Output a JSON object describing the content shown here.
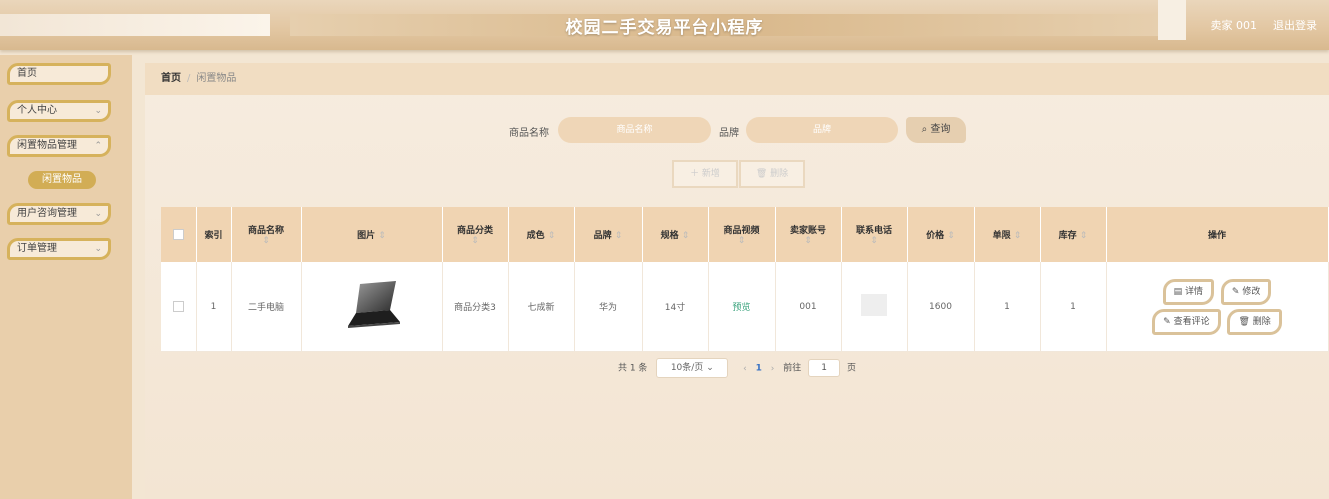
{
  "header": {
    "title": "校园二手交易平台小程序",
    "user": "卖家 001",
    "logout": "退出登录"
  },
  "sidebar": {
    "items": [
      {
        "label": "首页"
      },
      {
        "label": "个人中心"
      },
      {
        "label": "闲置物品管理"
      },
      {
        "label": "闲置物品"
      },
      {
        "label": "用户咨询管理"
      },
      {
        "label": "订单管理"
      }
    ]
  },
  "breadcrumb": {
    "home": "首页",
    "current": "闲置物品"
  },
  "search": {
    "name_label": "商品名称",
    "name_placeholder": "商品名称",
    "brand_label": "品牌",
    "brand_placeholder": "品牌",
    "query": "查询"
  },
  "actions": {
    "add": "＋ 新增",
    "delete": "删除"
  },
  "table": {
    "headers": [
      "索引",
      "商品名称",
      "图片",
      "商品分类",
      "成色",
      "品牌",
      "规格",
      "商品视频",
      "卖家账号",
      "联系电话",
      "价格",
      "单限",
      "库存",
      "操作"
    ],
    "rows": [
      {
        "index": "1",
        "name": "二手电脑",
        "category": "商品分类3",
        "condition": "七成新",
        "brand": "华为",
        "spec": "14寸",
        "video": "预览",
        "seller": "001",
        "price": "1600",
        "limit": "1",
        "stock": "1"
      }
    ],
    "ops": {
      "detail": "详情",
      "edit": "修改",
      "comments": "查看评论",
      "delete": "删除"
    }
  },
  "pagination": {
    "total": "共 1 条",
    "page_size": "10条/页",
    "page": "1",
    "goto_label": "前往",
    "goto_value": "1",
    "page_unit": "页"
  }
}
